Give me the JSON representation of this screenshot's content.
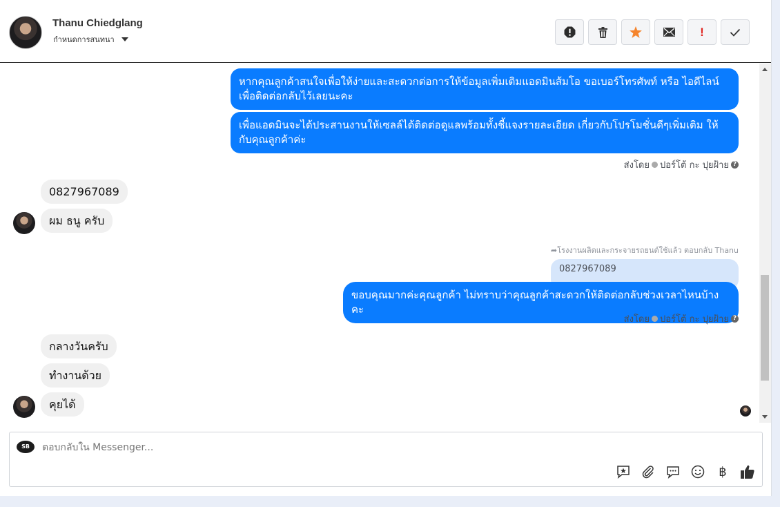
{
  "header": {
    "name": "Thanu Chiedglang",
    "subtitle": "กำหนดการสนทนา"
  },
  "messages": {
    "out1": "หากคุณลูกค้าสนใจเพื่อให้ง่ายและสะดวกต่อการให้ข้อมูลเพิ่มเติมแอดมินส้มโอ ขอเบอร์โทรศัพท์ หรือ ไอดีไลน์ เพื่อติดต่อกลับไว้เลยนะคะ",
    "out2": "เพื่อแอดมินจะได้ประสานงานให้เซลล์ได้ติดต่อดูแลพร้อมทั้งชี้แจงรายละเอียด เกี่ยวกับโปรโมชั่นดีๆเพิ่มเติม ให้กับคุณลูกค้าค่ะ",
    "sent_by_1": "ส่งโดย",
    "sender_1": "ปอร์โต้ กะ ปุยฝ้าย",
    "in1": "0827967089",
    "in2": "ผม ธนู ครับ",
    "reply_note": "โรงงานผลิตและกระจายรถยนต์ใช้แล้ว ตอบกลับ Thanu",
    "quoted": "0827967089",
    "out3": "ขอบคุณมากค่ะคุณลูกค้า ไม่ทราบว่าคุณลูกค้าสะดวกให้ติดต่อกลับช่วงเวลาไหนบ้างคะ",
    "sent_by_2": "ส่งโดย",
    "sender_2": "ปอร์โต้ กะ ปุยฝ้าย",
    "in3": "กลางวันครับ",
    "in4": "ทำงานด้วย",
    "in5": "คุยได้"
  },
  "composer": {
    "placeholder": "ตอบกลับใน Messenger...",
    "page_logo_text": "SB",
    "baht_symbol": "฿"
  },
  "colors": {
    "outgoing_bubble": "#0a7cff",
    "incoming_bubble": "#f0f0f0",
    "star": "#f5842c",
    "alert": "#e0241f"
  }
}
